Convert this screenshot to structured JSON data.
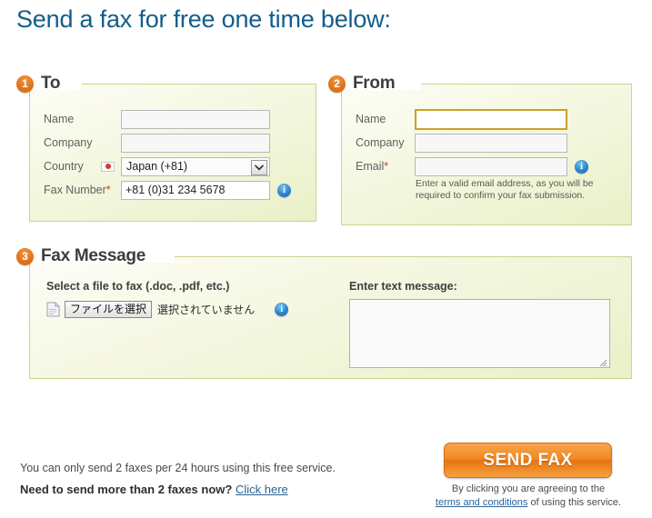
{
  "page": {
    "title": "Send a fax for free one time below:"
  },
  "sections": {
    "to": {
      "number": "1",
      "title": "To",
      "fields": {
        "name_label": "Name",
        "name_value": "",
        "company_label": "Company",
        "company_value": "",
        "country_label": "Country",
        "country_value": "Japan (+81)",
        "country_flag": "japan-flag-icon",
        "fax_label": "Fax Number",
        "fax_required": "*",
        "fax_value": "+81 (0)31 234 5678",
        "fax_info_icon": "info-icon"
      }
    },
    "from": {
      "number": "2",
      "title": "From",
      "fields": {
        "name_label": "Name",
        "name_value": "",
        "company_label": "Company",
        "company_value": "",
        "email_label": "Email",
        "email_required": "*",
        "email_value": "",
        "email_info_icon": "info-icon",
        "email_hint": "Enter a valid email address, as you will be required to confirm your fax submission."
      }
    },
    "fax_message": {
      "number": "3",
      "title": "Fax Message",
      "file_label": "Select a file to fax (.doc, .pdf, etc.)",
      "file_button": "ファイルを選択",
      "file_status": "選択されていません",
      "file_icon": "document-icon",
      "file_info_icon": "info-icon",
      "text_label": "Enter text message:",
      "text_value": "",
      "text_placeholder": ""
    }
  },
  "footer": {
    "limit_note": "You can only send 2 faxes per 24 hours using this free service.",
    "upgrade_prompt": "Need to send more than 2 faxes now?",
    "upgrade_link": "Click here",
    "send_button": "SEND FAX",
    "terms_prefix": "By clicking you are agreeing to the",
    "terms_link": "terms and conditions",
    "terms_suffix": "of using this service."
  },
  "colors": {
    "heading": "#145d8a",
    "badge": "#e0741a",
    "panel_border": "#cdd28f",
    "required_star": "#d03b2c",
    "link": "#2a6496",
    "send_button": "#ef8a20",
    "focus_border": "#c9a227",
    "info_icon": "#2a86d0"
  }
}
